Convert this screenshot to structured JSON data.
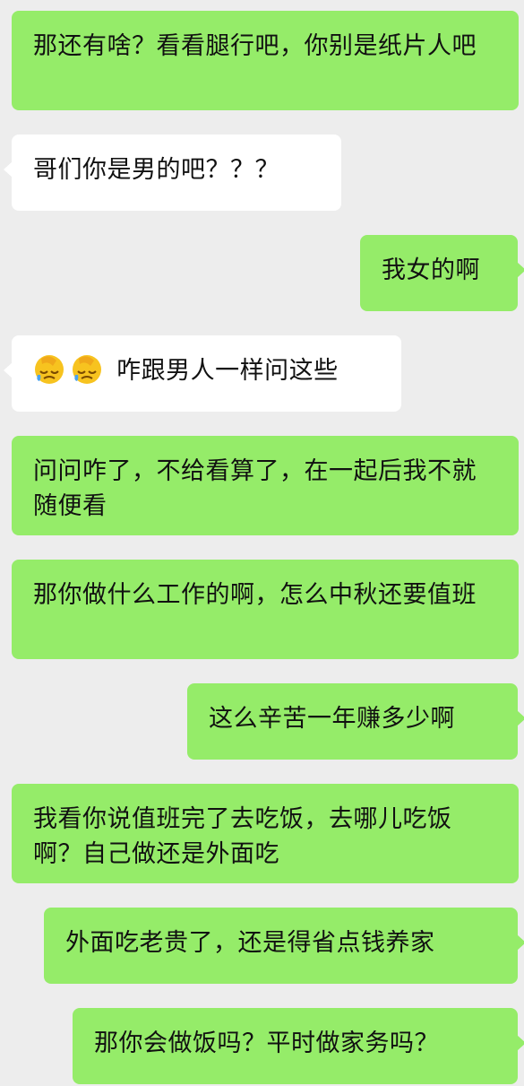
{
  "messages": [
    {
      "side": "sent",
      "text": "那还有啥？看看腿行吧，你别是纸片人吧"
    },
    {
      "side": "recv",
      "text": "哥们你是男的吧？？？"
    },
    {
      "side": "sent",
      "text": "我女的啊"
    },
    {
      "side": "recv",
      "emoji": [
        "face-palm-crying-emoji",
        "face-palm-crying-emoji"
      ],
      "text": "咋跟男人一样问这些"
    },
    {
      "side": "sent",
      "text": "问问咋了，不给看算了，在一起后我不就随便看"
    },
    {
      "side": "sent",
      "text": "那你做什么工作的啊，怎么中秋还要值班"
    },
    {
      "side": "sent",
      "text": "这么辛苦一年赚多少啊"
    },
    {
      "side": "sent",
      "text": "我看你说值班完了去吃饭，去哪儿吃饭啊？自己做还是外面吃"
    },
    {
      "side": "sent",
      "text": "外面吃老贵了，还是得省点钱养家"
    },
    {
      "side": "sent",
      "text": "那你会做饭吗？平时做家务吗？"
    }
  ],
  "colors": {
    "background": "#ededed",
    "sent_bubble": "#95ec69",
    "received_bubble": "#ffffff",
    "text": "#111111"
  }
}
